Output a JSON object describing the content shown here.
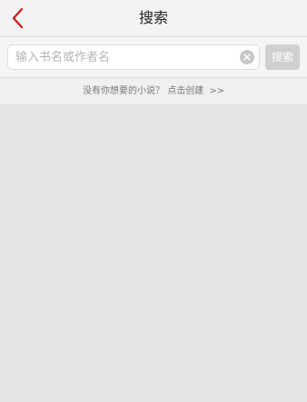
{
  "header": {
    "title": "搜索",
    "back_icon": "chevron-left-icon",
    "accent_color": "#cc2222"
  },
  "search": {
    "placeholder": "输入书名或作者名",
    "value": "",
    "clear_icon": "clear-icon",
    "button_label": "搜索"
  },
  "hint": {
    "text": "没有你想要的小说？ 点击创建",
    "arrows": ">>"
  }
}
